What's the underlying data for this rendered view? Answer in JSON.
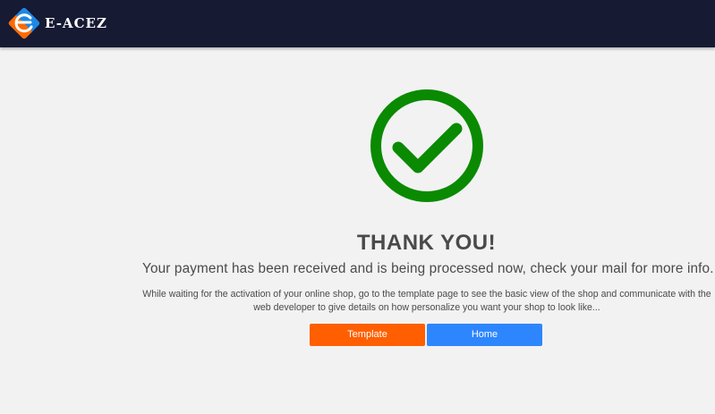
{
  "header": {
    "brand_name": "E-ACEZ",
    "logo_icon": "e-acez-logo-icon"
  },
  "main": {
    "status_icon": "check-circle-icon",
    "status_color": "#0a8a00",
    "title": "THANK YOU!",
    "subtitle": "Your payment has been received and is being processed now, check your mail for more info...",
    "note": "While waiting for the activation of your online shop, go to the template page to see the basic view of the shop and communicate with the web developer to give details on how personalize you want your shop to look like...",
    "buttons": {
      "template_label": "Template",
      "template_color": "#ff5f00",
      "home_label": "Home",
      "home_color": "#2e86ff"
    }
  },
  "colors": {
    "navbar_bg": "#161a33",
    "page_bg": "#f2f2f2"
  }
}
